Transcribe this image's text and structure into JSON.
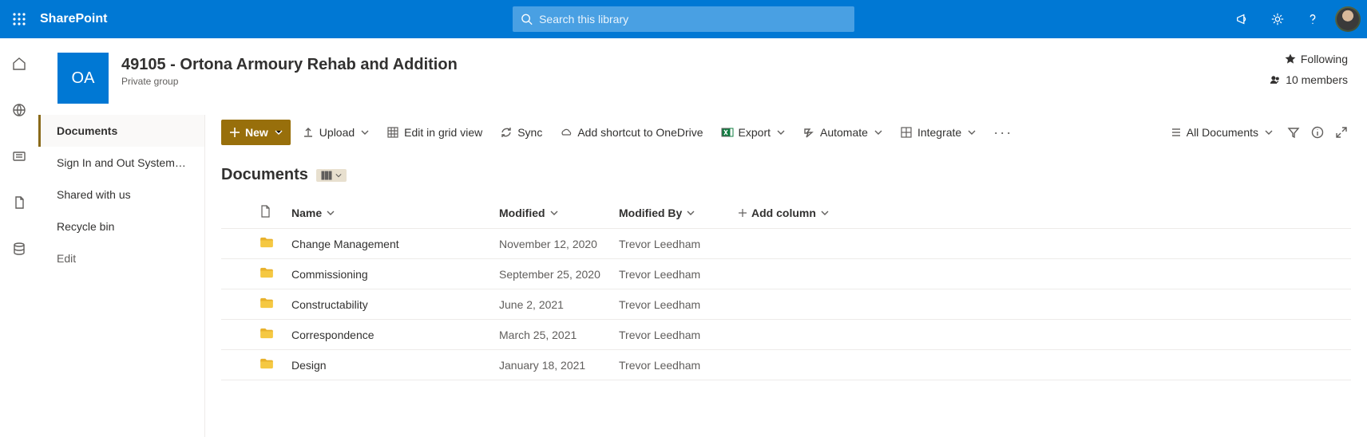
{
  "suite": {
    "brand": "SharePoint",
    "search_placeholder": "Search this library"
  },
  "site": {
    "tile": "OA",
    "title": "49105 - Ortona Armoury Rehab and Addition",
    "subtitle": "Private group",
    "following": "Following",
    "members": "10 members"
  },
  "leftnav": {
    "items": [
      {
        "label": "Documents",
        "active": true
      },
      {
        "label": "Sign In and Out System (...",
        "active": false
      },
      {
        "label": "Shared with us",
        "active": false
      },
      {
        "label": "Recycle bin",
        "active": false
      }
    ],
    "edit": "Edit"
  },
  "commands": {
    "new": "New",
    "upload": "Upload",
    "edit_grid": "Edit in grid view",
    "sync": "Sync",
    "shortcut": "Add shortcut to OneDrive",
    "export": "Export",
    "automate": "Automate",
    "integrate": "Integrate",
    "view": "All Documents"
  },
  "library": {
    "heading": "Documents",
    "columns": {
      "name": "Name",
      "modified": "Modified",
      "modified_by": "Modified By",
      "add": "Add column"
    },
    "rows": [
      {
        "name": "Change Management",
        "modified": "November 12, 2020",
        "by": "Trevor Leedham"
      },
      {
        "name": "Commissioning",
        "modified": "September 25, 2020",
        "by": "Trevor Leedham"
      },
      {
        "name": "Constructability",
        "modified": "June 2, 2021",
        "by": "Trevor Leedham"
      },
      {
        "name": "Correspondence",
        "modified": "March 25, 2021",
        "by": "Trevor Leedham"
      },
      {
        "name": "Design",
        "modified": "January 18, 2021",
        "by": "Trevor Leedham"
      }
    ]
  }
}
